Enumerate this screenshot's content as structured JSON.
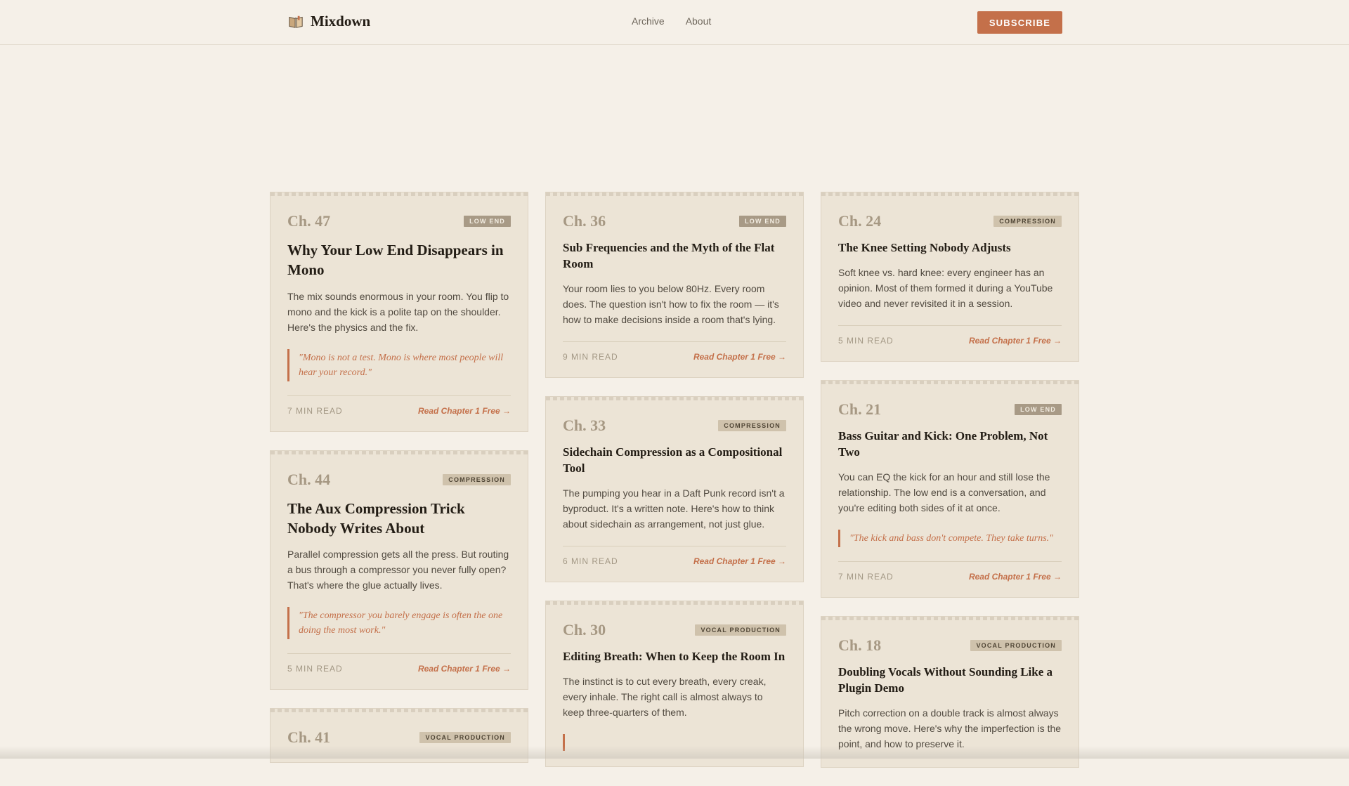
{
  "header": {
    "brand_name": "Mixdown",
    "nav": [
      "Archive",
      "About"
    ],
    "subscribe_label": "SUBSCRIBE"
  },
  "columns": [
    [
      {
        "chapter": "Ch. 47",
        "tag": "LOW END",
        "title": "Why Your Low End Disappears in Mono",
        "excerpt": "The mix sounds enormous in your room. You flip to mono and the kick is a polite tap on the shoulder. Here's the physics and the fix.",
        "quote": "\"Mono is not a test. Mono is where most people will hear your record.\"",
        "read_time": "7 MIN READ",
        "cta": "Read Chapter 1 Free →"
      },
      {
        "chapter": "Ch. 44",
        "tag": "COMPRESSION",
        "title": "The Aux Compression Trick Nobody Writes About",
        "excerpt": "Parallel compression gets all the press. But routing a bus through a compressor you never fully open? That's where the glue actually lives.",
        "quote": "\"The compressor you barely engage is often the one doing the most work.\"",
        "read_time": "5 MIN READ",
        "cta": "Read Chapter 1 Free →"
      },
      {
        "chapter": "Ch. 41",
        "tag": "VOCAL PRODUCTION"
      }
    ],
    [
      {
        "chapter": "Ch. 36",
        "tag": "LOW END",
        "title": "Sub Frequencies and the Myth of the Flat Room",
        "excerpt": "Your room lies to you below 80Hz. Every room does. The question isn't how to fix the room — it's how to make decisions inside a room that's lying.",
        "read_time": "9 MIN READ",
        "cta": "Read Chapter 1 Free →"
      },
      {
        "chapter": "Ch. 33",
        "tag": "COMPRESSION",
        "title": "Sidechain Compression as a Compositional Tool",
        "excerpt": "The pumping you hear in a Daft Punk record isn't a byproduct. It's a written note. Here's how to think about sidechain as arrangement, not just glue.",
        "read_time": "6 MIN READ",
        "cta": "Read Chapter 1 Free →"
      },
      {
        "chapter": "Ch. 30",
        "tag": "VOCAL PRODUCTION",
        "title": "Editing Breath: When to Keep the Room In",
        "excerpt": "The instinct is to cut every breath, every creak, every inhale. The right call is almost always to keep three-quarters of them."
      }
    ],
    [
      {
        "chapter": "Ch. 24",
        "tag": "COMPRESSION",
        "title": "The Knee Setting Nobody Adjusts",
        "excerpt": "Soft knee vs. hard knee: every engineer has an opinion. Most of them formed it during a YouTube video and never revisited it in a session.",
        "read_time": "5 MIN READ",
        "cta": "Read Chapter 1 Free →"
      },
      {
        "chapter": "Ch. 21",
        "tag": "LOW END",
        "title": "Bass Guitar and Kick: One Problem, Not Two",
        "excerpt": "You can EQ the kick for an hour and still lose the relationship. The low end is a conversation, and you're editing both sides of it at once.",
        "quote": "\"The kick and bass don't compete. They take turns.\"",
        "read_time": "7 MIN READ",
        "cta": "Read Chapter 1 Free →"
      },
      {
        "chapter": "Ch. 18",
        "tag": "VOCAL PRODUCTION",
        "title": "Doubling Vocals Without Sounding Like a Plugin Demo",
        "excerpt": "Pitch correction on a double track is almost always the wrong move. Here's why the imperfection is the point, and how to preserve it."
      }
    ]
  ]
}
